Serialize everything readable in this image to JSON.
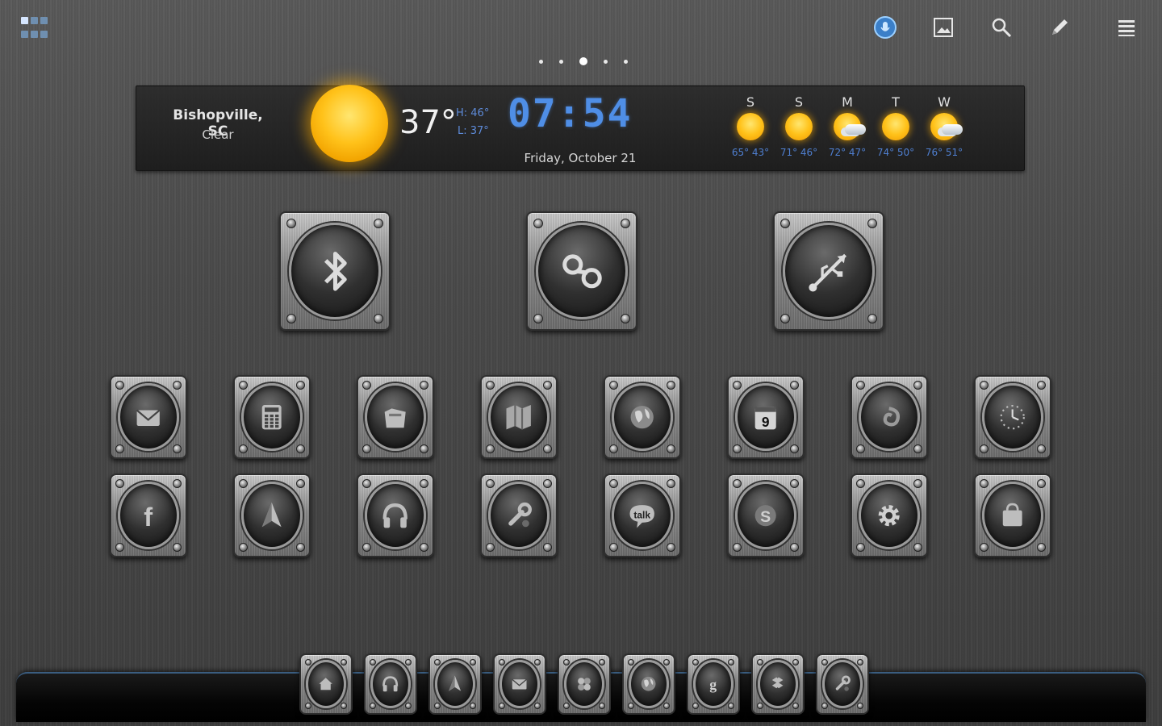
{
  "statusbar": {
    "icons": [
      "apps-grid-icon",
      "voice-search-icon",
      "wallpaper-icon",
      "search-icon",
      "pencil-icon",
      "menu-icon"
    ]
  },
  "home_pages": {
    "count": 5,
    "active": 3
  },
  "weather": {
    "location": "Bishopville, SC",
    "condition": "Clear",
    "current_temp": "37°",
    "high": "H: 46°",
    "low": "L: 37°",
    "time": "07:54",
    "date": "Friday, October 21",
    "forecast": [
      {
        "day": "S",
        "temps": "65° 43°",
        "icon": "sunny-icon"
      },
      {
        "day": "S",
        "temps": "71° 46°",
        "icon": "sunny-icon"
      },
      {
        "day": "M",
        "temps": "72° 47°",
        "icon": "partly-cloudy-icon"
      },
      {
        "day": "T",
        "temps": "74° 50°",
        "icon": "sunny-icon"
      },
      {
        "day": "W",
        "temps": "76° 51°",
        "icon": "partly-cloudy-icon"
      }
    ]
  },
  "toggles": [
    {
      "name": "bluetooth-toggle",
      "icon": "bluetooth-icon"
    },
    {
      "name": "voicemail-toggle",
      "icon": "voicemail-icon"
    },
    {
      "name": "usb-toggle",
      "icon": "usb-icon"
    }
  ],
  "apps_row1": [
    {
      "name": "mail-app",
      "icon": "envelope-icon"
    },
    {
      "name": "calculator-app",
      "icon": "calculator-icon"
    },
    {
      "name": "files-app",
      "icon": "folder-icon"
    },
    {
      "name": "maps-app",
      "icon": "map-icon"
    },
    {
      "name": "browser-app",
      "icon": "globe-icon"
    },
    {
      "name": "calendar-app",
      "icon": "calendar-icon",
      "label": "9"
    },
    {
      "name": "music-app",
      "icon": "music-swirl-icon"
    },
    {
      "name": "clock-app",
      "icon": "clock-icon"
    }
  ],
  "apps_row2": [
    {
      "name": "facebook-app",
      "icon": "facebook-icon",
      "label": "f"
    },
    {
      "name": "navigation-app",
      "icon": "navigation-arrow-icon"
    },
    {
      "name": "headphones-app",
      "icon": "headphones-icon"
    },
    {
      "name": "tools-app",
      "icon": "wrench-icon"
    },
    {
      "name": "talk-app",
      "icon": "talk-bubble-icon",
      "label": "talk"
    },
    {
      "name": "skype-app",
      "icon": "skype-icon",
      "label": "S"
    },
    {
      "name": "settings-app",
      "icon": "gear-icon"
    },
    {
      "name": "market-app",
      "icon": "shopping-bag-icon"
    }
  ],
  "dock": [
    {
      "name": "dock-home",
      "icon": "home-icon"
    },
    {
      "name": "dock-headphones",
      "icon": "headphones-icon"
    },
    {
      "name": "dock-navigation",
      "icon": "navigation-arrow-icon"
    },
    {
      "name": "dock-mail",
      "icon": "envelope-icon"
    },
    {
      "name": "dock-apps",
      "icon": "app-cluster-icon"
    },
    {
      "name": "dock-browser",
      "icon": "globe-icon"
    },
    {
      "name": "dock-google",
      "icon": "google-icon",
      "label": "g"
    },
    {
      "name": "dock-dropbox",
      "icon": "dropbox-icon"
    },
    {
      "name": "dock-tools",
      "icon": "wrench-icon"
    }
  ]
}
